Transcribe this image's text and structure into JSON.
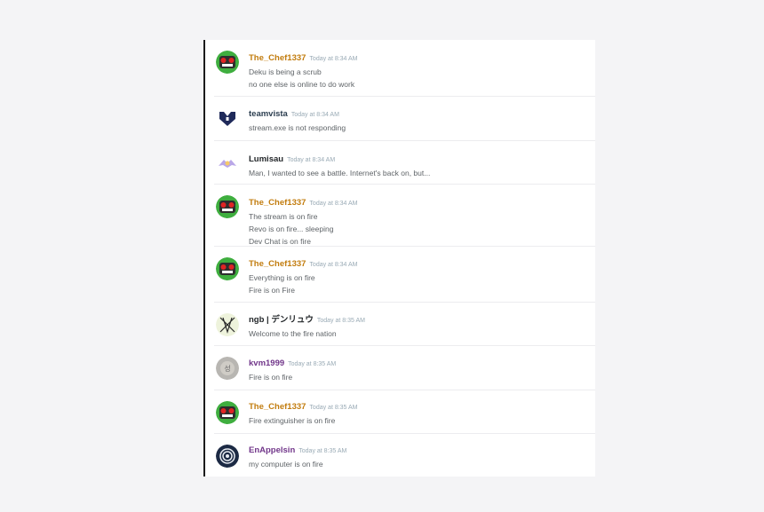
{
  "colors": {
    "chef": "#c27c0e",
    "teamvista": "#2c3e50",
    "lumisau": "#23272a",
    "ngb": "#23272a",
    "purple": "#71368a"
  },
  "messages": [
    {
      "user": "The_Chef1337",
      "time": "Today at 8:34 AM",
      "lines": [
        "Deku is being a scrub",
        "no one else is online to do work"
      ],
      "avatar": "robot-avatar-icon"
    },
    {
      "user": "teamvista",
      "time": "Today at 8:34 AM",
      "lines": [
        "stream.exe is not responding"
      ],
      "avatar": "shield-avatar-icon"
    },
    {
      "user": "Lumisau",
      "time": "Today at 8:34 AM",
      "lines": [
        "Man, I wanted to see a battle. Internet's back on, but..."
      ],
      "avatar": "creature-avatar-icon"
    },
    {
      "user": "The_Chef1337",
      "time": "Today at 8:34 AM",
      "lines": [
        "The stream is on fire",
        "Revo is on fire... sleeping",
        "Dev Chat is on fire"
      ],
      "avatar": "robot-avatar-icon"
    },
    {
      "user": "The_Chef1337",
      "time": "Today at 8:34 AM",
      "lines": [
        "Everything is on fire",
        "Fire is on Fire"
      ],
      "avatar": "robot-avatar-icon"
    },
    {
      "user": "ngb | デンリュウ",
      "time": "Today at 8:35 AM",
      "lines": [
        "Welcome to the fire nation"
      ],
      "avatar": "geometric-avatar-icon"
    },
    {
      "user": "kvm1999",
      "time": "Today at 8:35 AM",
      "lines": [
        "Fire is on fire"
      ],
      "avatar": "gray-avatar-icon"
    },
    {
      "user": "The_Chef1337",
      "time": "Today at 8:35 AM",
      "lines": [
        "Fire extinguisher is on fire"
      ],
      "avatar": "robot-avatar-icon"
    },
    {
      "user": "EnAppelsin",
      "time": "Today at 8:35 AM",
      "lines": [
        "my computer is on fire"
      ],
      "avatar": "spiral-avatar-icon"
    }
  ]
}
